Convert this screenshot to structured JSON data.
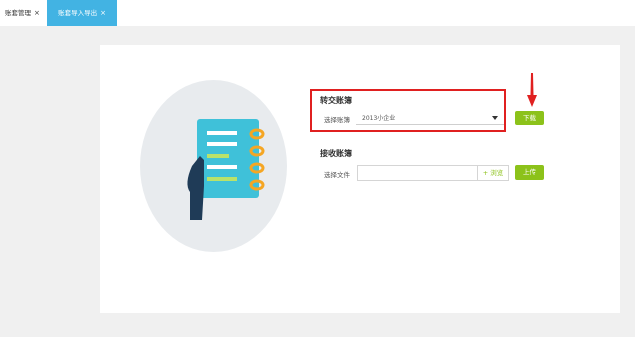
{
  "tabs": [
    {
      "label": "账套管理",
      "close": "×",
      "active": false
    },
    {
      "label": "账套导入导出",
      "close": "×",
      "active": true
    }
  ],
  "export_section": {
    "title": "转交账簿",
    "field_label": "选择账簿",
    "selected_value": "2013小企业",
    "button_label": "下载"
  },
  "import_section": {
    "title": "接收账簿",
    "field_label": "选择文件",
    "file_value": "",
    "browse_label": "+ 浏览",
    "button_label": "上传"
  },
  "colors": {
    "accent": "#42b3e3",
    "button": "#8cc21a",
    "highlight": "#e02020"
  },
  "icons": [
    "notebook-illustration",
    "chevron-down-icon",
    "red-arrow-indicator"
  ]
}
